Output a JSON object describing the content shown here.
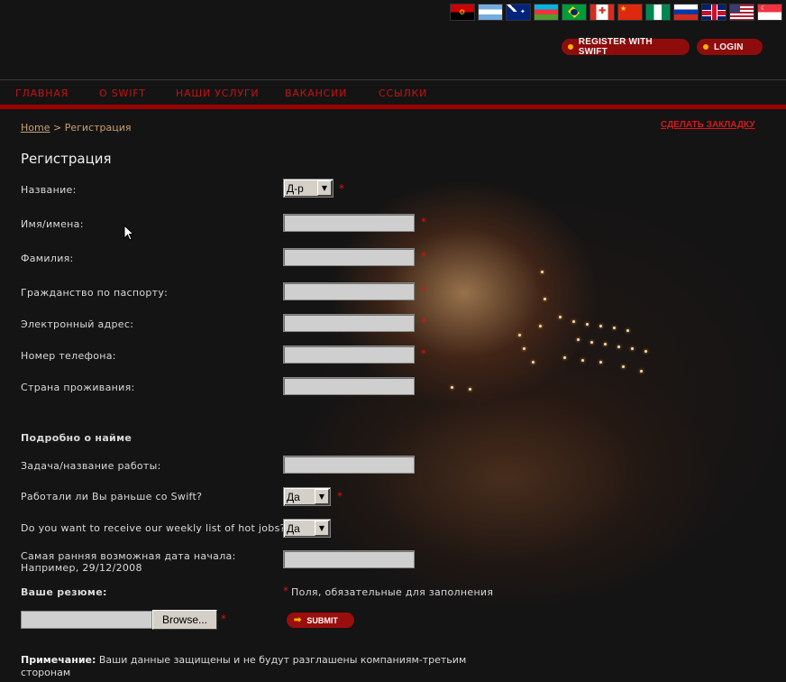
{
  "header": {
    "flags": [
      "angola",
      "argentina",
      "australia",
      "azerbaijan",
      "brazil",
      "canada",
      "china",
      "nigeria",
      "russia",
      "uk",
      "usa",
      "singapore"
    ],
    "register_label": "REGISTER WITH SWIFT",
    "login_label": "LOGIN"
  },
  "nav": {
    "items": [
      "ГЛАВНАЯ",
      "О SWIFT",
      "НАШИ УСЛУГИ",
      "ВАКАНСИИ",
      "ССЫЛКИ"
    ]
  },
  "breadcrumb": {
    "home": "Home",
    "separator": ">",
    "current": "Регистрация"
  },
  "bookmark_label": "СДЕЛАТЬ ЗАКЛАДКУ",
  "page_title": "Регистрация",
  "form": {
    "title_label": "Название:",
    "title_value": "Д-р",
    "first_name_label": "Имя/имена:",
    "last_name_label": "Фамилия:",
    "citizenship_label": "Гражданство по паспорту:",
    "email_label": "Электронный адрес:",
    "phone_label": "Номер телефона:",
    "country_label": "Страна проживания:",
    "required_mark": "*",
    "section_employment": "Подробно о найме",
    "job_title_label": "Задача/название работы:",
    "worked_before_label": "Работали ли Вы раньше со Swift?",
    "worked_before_value": "Да",
    "hot_jobs_label": "Do you want to receive our weekly list of hot jobs?",
    "hot_jobs_value": "Да",
    "start_date_label": "Самая ранняя возможная дата начала:",
    "start_date_example": "Например, 29/12/2008",
    "resume_label": "Ваше резюме:",
    "required_note": "Поля, обязательные для заполнения",
    "browse_label": "Browse...",
    "submit_label": "SUBMIT"
  },
  "note": {
    "bold": "Примечание:",
    "text": "Ваши данные защищены и не будут разглашены компаниям-третьим сторонам"
  },
  "colors": {
    "background": "#141414",
    "accent_red": "#c41313",
    "bar_red": "#9c0000",
    "pill_red": "#8e0c0c",
    "dot_yellow": "#f4b400"
  }
}
